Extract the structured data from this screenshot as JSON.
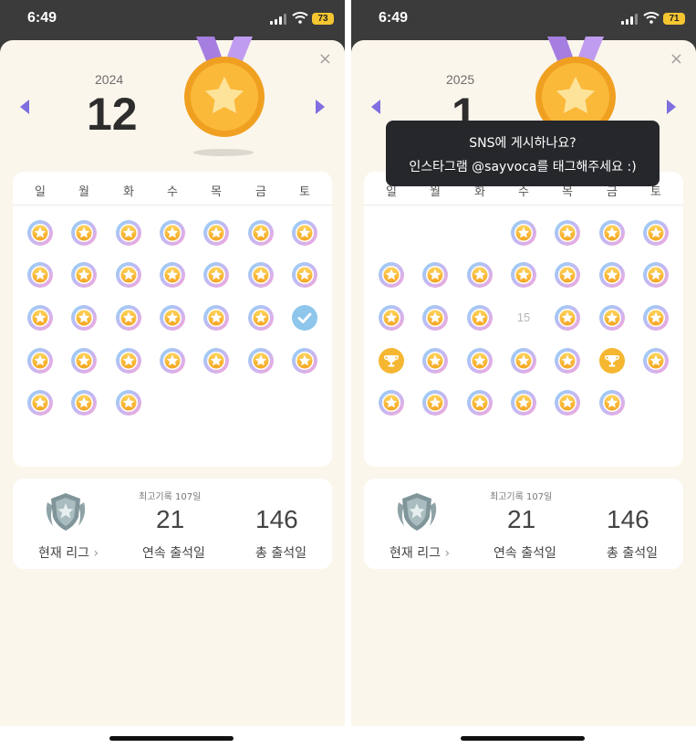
{
  "left_screen": {
    "status": {
      "time": "6:49",
      "battery": "73"
    },
    "close_icon": "×",
    "year": "2024",
    "month": "12",
    "weekdays": [
      "일",
      "월",
      "화",
      "수",
      "목",
      "금",
      "토"
    ],
    "calendar_note": "December 2024: days 1-31 all attended (star badges); day 21 shown with a check mark badge",
    "stats": {
      "league_label": "현재 리그",
      "best_record": "최고기록 107일",
      "streak_value": "21",
      "streak_label": "연속 출석일",
      "total_value": "146",
      "total_label": "총 출석일"
    }
  },
  "right_screen": {
    "status": {
      "time": "6:49",
      "battery": "71"
    },
    "close_icon": "×",
    "year": "2025",
    "month": "1",
    "weekdays": [
      "일",
      "월",
      "화",
      "수",
      "목",
      "금",
      "토"
    ],
    "day_15_text": "15",
    "calendar_note": "January 2025: starts on Wednesday; day 15 not attended (plain number); days 19 and 24 have trophy badges",
    "tooltip": {
      "line1": "SNS에 게시하나요?",
      "line2": "인스타그램 @sayvoca를 태그해주세요 :)"
    },
    "stats": {
      "league_label": "현재 리그",
      "best_record": "최고기록 107일",
      "streak_value": "21",
      "streak_label": "연속 출석일",
      "total_value": "146",
      "total_label": "총 출석일"
    }
  },
  "colors": {
    "sheet_bg": "#fbf6ec",
    "accent_arrow": "#7f6fe0",
    "medal_gold": "#f5a623",
    "ribbon_purple": "#b48ee8",
    "badge_blue": "#8fd3f4",
    "badge_pink": "#f6a6d8",
    "check_blue": "#8ec6ec",
    "trophy_gold": "#f5b731",
    "tooltip_bg": "#25272b"
  }
}
